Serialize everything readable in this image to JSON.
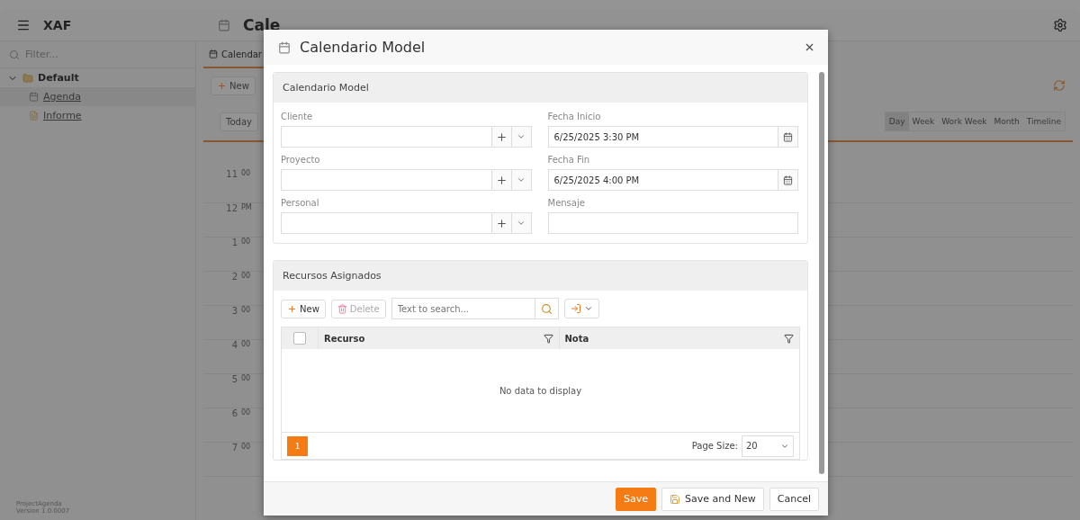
{
  "app": {
    "title": "XAF",
    "filter_placeholder": "Filter...",
    "nav": [
      {
        "label": "Default",
        "expanded": true,
        "children": [
          {
            "label": "Agenda",
            "selected": true
          },
          {
            "label": "Informe",
            "selected": false
          }
        ]
      }
    ],
    "footer": [
      "ProjectAgenda",
      "Version 1.0.0007"
    ],
    "page_title": "Cale",
    "tab": "Calendar",
    "new_button": "New",
    "today_button": "Today",
    "views": [
      {
        "label": "Day",
        "selected": true
      },
      {
        "label": "Week",
        "selected": false
      },
      {
        "label": "Work Week",
        "selected": false
      },
      {
        "label": "Month",
        "selected": false
      },
      {
        "label": "Timeline",
        "selected": false
      }
    ],
    "hours": [
      {
        "hour": "11",
        "suffix": "00"
      },
      {
        "hour": "12",
        "suffix": "PM"
      },
      {
        "hour": "1",
        "suffix": "00"
      },
      {
        "hour": "2",
        "suffix": "00"
      },
      {
        "hour": "3",
        "suffix": "00"
      },
      {
        "hour": "4",
        "suffix": "00"
      },
      {
        "hour": "5",
        "suffix": "00"
      },
      {
        "hour": "6",
        "suffix": "00"
      },
      {
        "hour": "7",
        "suffix": "00"
      }
    ]
  },
  "dialog": {
    "title": "Calendario Model",
    "section_title": "Calendario Model",
    "fields": [
      {
        "label": "Cliente",
        "kind": "lookup"
      },
      {
        "label": "Fecha Inicio",
        "kind": "date",
        "value": "6/25/2025 3:30 PM"
      },
      {
        "label": "Proyecto",
        "kind": "lookup"
      },
      {
        "label": "Fecha Fin",
        "kind": "date",
        "value": "6/25/2025 4:00 PM"
      },
      {
        "label": "Personal",
        "kind": "lookup"
      },
      {
        "label": "Mensaje",
        "kind": "text"
      }
    ],
    "resources": {
      "title": "Recursos Asignados",
      "new_button": "New",
      "delete_button": "Delete",
      "delete_disabled": true,
      "search_placeholder": "Text to search...",
      "select_all_checked": false,
      "columns": [
        "Recurso",
        "Nota"
      ],
      "empty": "No data to display",
      "pages": [
        {
          "label": "1",
          "selected": true
        }
      ],
      "page_size_label": "Page Size:",
      "page_size": "20"
    },
    "buttons": [
      {
        "label": "Save",
        "kind": "primary"
      },
      {
        "label": "Save and New",
        "kind": "save-new"
      },
      {
        "label": "Cancel",
        "kind": "plain"
      }
    ]
  }
}
